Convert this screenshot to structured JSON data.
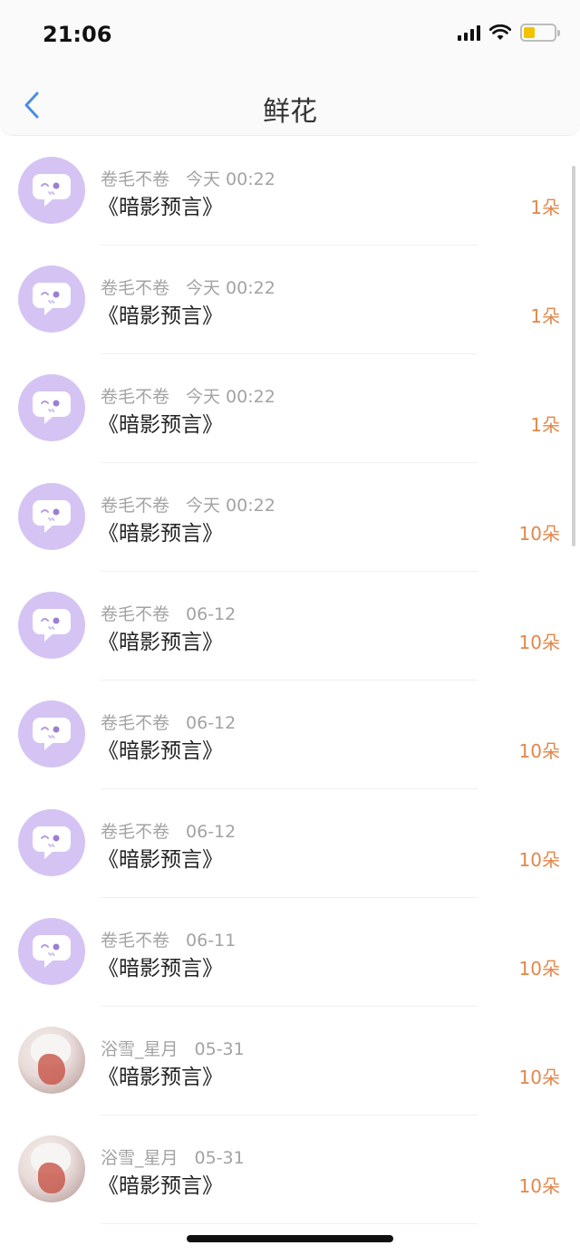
{
  "status_bar": {
    "time": "21:06"
  },
  "header": {
    "title": "鲜花"
  },
  "items": [
    {
      "user": "卷毛不卷",
      "time": "今天 00:22",
      "book": "《暗影预言》",
      "amount": "1朵",
      "avatar": "default"
    },
    {
      "user": "卷毛不卷",
      "time": "今天 00:22",
      "book": "《暗影预言》",
      "amount": "1朵",
      "avatar": "default"
    },
    {
      "user": "卷毛不卷",
      "time": "今天 00:22",
      "book": "《暗影预言》",
      "amount": "1朵",
      "avatar": "default"
    },
    {
      "user": "卷毛不卷",
      "time": "今天 00:22",
      "book": "《暗影预言》",
      "amount": "10朵",
      "avatar": "default"
    },
    {
      "user": "卷毛不卷",
      "time": "06-12",
      "book": "《暗影预言》",
      "amount": "10朵",
      "avatar": "default"
    },
    {
      "user": "卷毛不卷",
      "time": "06-12",
      "book": "《暗影预言》",
      "amount": "10朵",
      "avatar": "default"
    },
    {
      "user": "卷毛不卷",
      "time": "06-12",
      "book": "《暗影预言》",
      "amount": "10朵",
      "avatar": "default"
    },
    {
      "user": "卷毛不卷",
      "time": "06-11",
      "book": "《暗影预言》",
      "amount": "10朵",
      "avatar": "default"
    },
    {
      "user": "浴雪_星月",
      "time": "05-31",
      "book": "《暗影预言》",
      "amount": "10朵",
      "avatar": "photo"
    },
    {
      "user": "浴雪_星月",
      "time": "05-31",
      "book": "《暗影预言》",
      "amount": "10朵",
      "avatar": "photo"
    }
  ],
  "icons": {
    "back": "chevron-left-icon",
    "signal": "cellular-signal-icon",
    "wifi": "wifi-icon",
    "battery": "battery-icon",
    "default_avatar": "chat-bubble-face-icon"
  },
  "colors": {
    "accent": "#4a90e2",
    "amount": "#e2874a",
    "avatar_bg": "#d5c4f3",
    "battery": "#f2c400"
  }
}
